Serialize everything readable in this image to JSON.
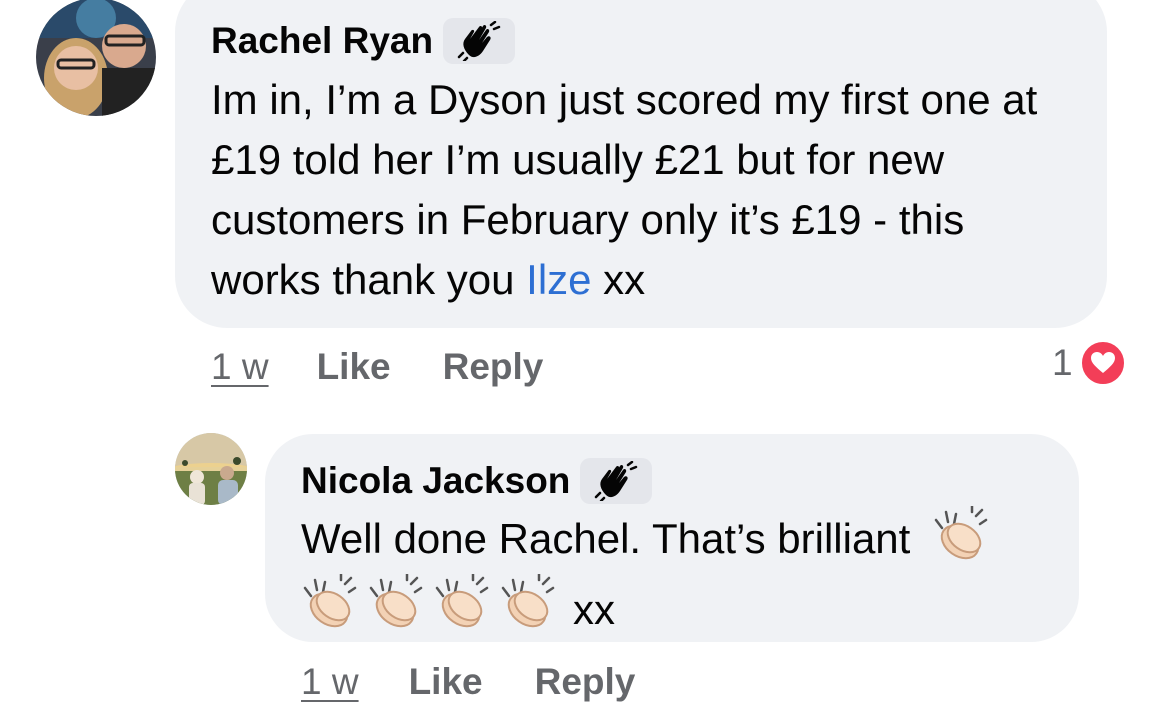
{
  "comments": [
    {
      "author": "Rachel Ryan",
      "badge_icon": "wave-hand-icon",
      "text_before_mention": "Im in, I’m a Dyson just scored my first one at £19 told her I’m usually £21 but for new customers in February only it’s £19 - this works thank you ",
      "mention": "Ilze",
      "text_after_mention": " xx",
      "time": "1 w",
      "like_label": "Like",
      "reply_label": "Reply",
      "reaction_count": "1",
      "reaction_icon": "heart-icon"
    },
    {
      "author": "Nicola Jackson",
      "badge_icon": "wave-hand-icon",
      "text": "Well done Rachel. That’s brilliant",
      "trailing_text": "xx",
      "emoji": "clapping-hands-icon",
      "emoji_count": 5,
      "time": "1 w",
      "like_label": "Like",
      "reply_label": "Reply"
    }
  ],
  "colors": {
    "bubble": "#f0f2f5",
    "mention": "#2d6fd3",
    "meta": "#65676b",
    "heart": "#f33e58"
  }
}
